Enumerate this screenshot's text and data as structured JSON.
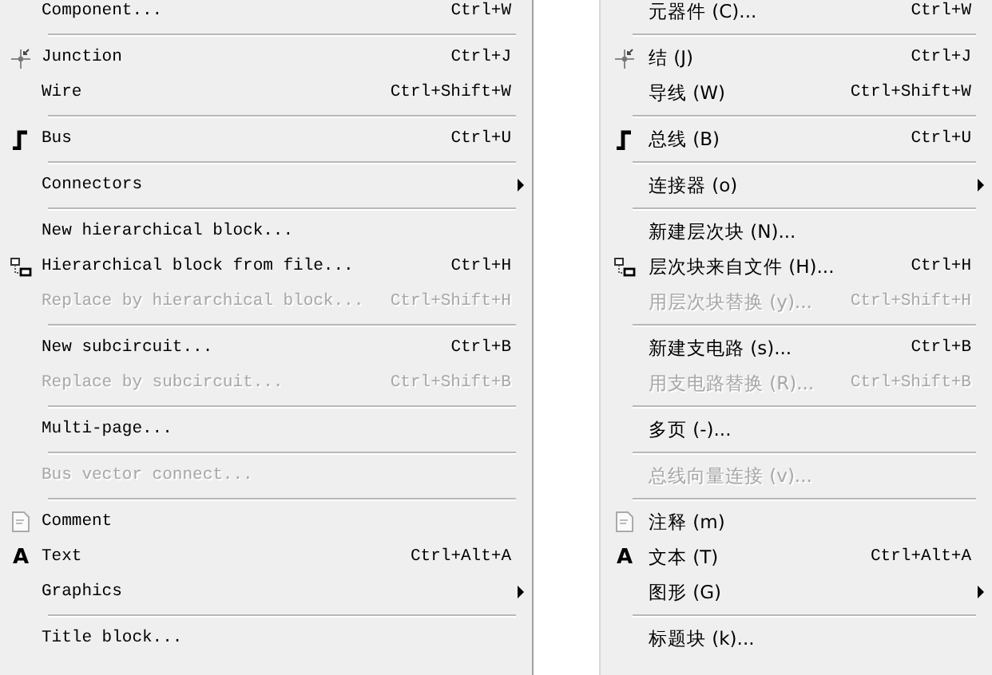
{
  "menus": [
    {
      "items": [
        {
          "kind": "item",
          "label": "Component...",
          "shortcut": "Ctrl+W",
          "disabled": false
        },
        {
          "kind": "separator"
        },
        {
          "kind": "junction",
          "label": "Junction",
          "shortcut": "Ctrl+J",
          "disabled": false
        },
        {
          "kind": "item",
          "label": "Wire",
          "shortcut": "Ctrl+Shift+W",
          "disabled": false
        },
        {
          "kind": "separator"
        },
        {
          "kind": "bus",
          "label": "Bus",
          "shortcut": "Ctrl+U",
          "disabled": false
        },
        {
          "kind": "separator"
        },
        {
          "kind": "item",
          "label": "Connectors",
          "disabled": false,
          "submenu": true
        },
        {
          "kind": "separator"
        },
        {
          "kind": "item",
          "label": "New hierarchical block...",
          "disabled": false
        },
        {
          "kind": "hierarchy",
          "label": "Hierarchical block from file...",
          "shortcut": "Ctrl+H",
          "disabled": false
        },
        {
          "kind": "item",
          "label": "Replace by hierarchical block...",
          "shortcut": "Ctrl+Shift+H",
          "disabled": true
        },
        {
          "kind": "separator"
        },
        {
          "kind": "item",
          "label": "New subcircuit...",
          "shortcut": "Ctrl+B",
          "disabled": false
        },
        {
          "kind": "item",
          "label": "Replace by subcircuit...",
          "shortcut": "Ctrl+Shift+B",
          "disabled": true
        },
        {
          "kind": "separator"
        },
        {
          "kind": "item",
          "label": "Multi-page...",
          "disabled": false
        },
        {
          "kind": "separator"
        },
        {
          "kind": "item",
          "label": "Bus vector connect...",
          "disabled": true
        },
        {
          "kind": "separator"
        },
        {
          "kind": "comment",
          "label": "Comment",
          "disabled": false
        },
        {
          "kind": "item",
          "label": "Text",
          "shortcut": "Ctrl+Alt+A",
          "disabled": false,
          "glyph": "A"
        },
        {
          "kind": "item",
          "label": "Graphics",
          "disabled": false,
          "submenu": true
        },
        {
          "kind": "separator"
        },
        {
          "kind": "item",
          "label": "Title block...",
          "disabled": false
        }
      ]
    },
    {
      "items": [
        {
          "kind": "item",
          "label": "元器件 (C)...",
          "shortcut": "Ctrl+W",
          "disabled": false
        },
        {
          "kind": "separator"
        },
        {
          "kind": "junction",
          "label": "结 (J)",
          "shortcut": "Ctrl+J",
          "disabled": false
        },
        {
          "kind": "item",
          "label": "导线 (W)",
          "shortcut": "Ctrl+Shift+W",
          "disabled": false
        },
        {
          "kind": "separator"
        },
        {
          "kind": "bus",
          "label": "总线 (B)",
          "shortcut": "Ctrl+U",
          "disabled": false
        },
        {
          "kind": "separator"
        },
        {
          "kind": "item",
          "label": "连接器 (o)",
          "disabled": false,
          "submenu": true
        },
        {
          "kind": "separator"
        },
        {
          "kind": "item",
          "label": "新建层次块 (N)...",
          "disabled": false
        },
        {
          "kind": "hierarchy",
          "label": "层次块来自文件 (H)...",
          "shortcut": "Ctrl+H",
          "disabled": false
        },
        {
          "kind": "item",
          "label": "用层次块替换 (y)...",
          "shortcut": "Ctrl+Shift+H",
          "disabled": true
        },
        {
          "kind": "separator"
        },
        {
          "kind": "item",
          "label": "新建支电路 (s)...",
          "shortcut": "Ctrl+B",
          "disabled": false
        },
        {
          "kind": "item",
          "label": "用支电路替换 (R)...",
          "shortcut": "Ctrl+Shift+B",
          "disabled": true
        },
        {
          "kind": "separator"
        },
        {
          "kind": "item",
          "label": "多页 (-)...",
          "disabled": false
        },
        {
          "kind": "separator"
        },
        {
          "kind": "item",
          "label": "总线向量连接 (v)...",
          "disabled": true
        },
        {
          "kind": "separator"
        },
        {
          "kind": "comment",
          "label": "注释 (m)",
          "disabled": false
        },
        {
          "kind": "item",
          "label": "文本 (T)",
          "shortcut": "Ctrl+Alt+A",
          "disabled": false,
          "glyph": "A"
        },
        {
          "kind": "item",
          "label": "图形 (G)",
          "disabled": false,
          "submenu": true
        },
        {
          "kind": "separator"
        },
        {
          "kind": "item",
          "label": "标题块 (k)...",
          "disabled": false
        }
      ]
    }
  ]
}
